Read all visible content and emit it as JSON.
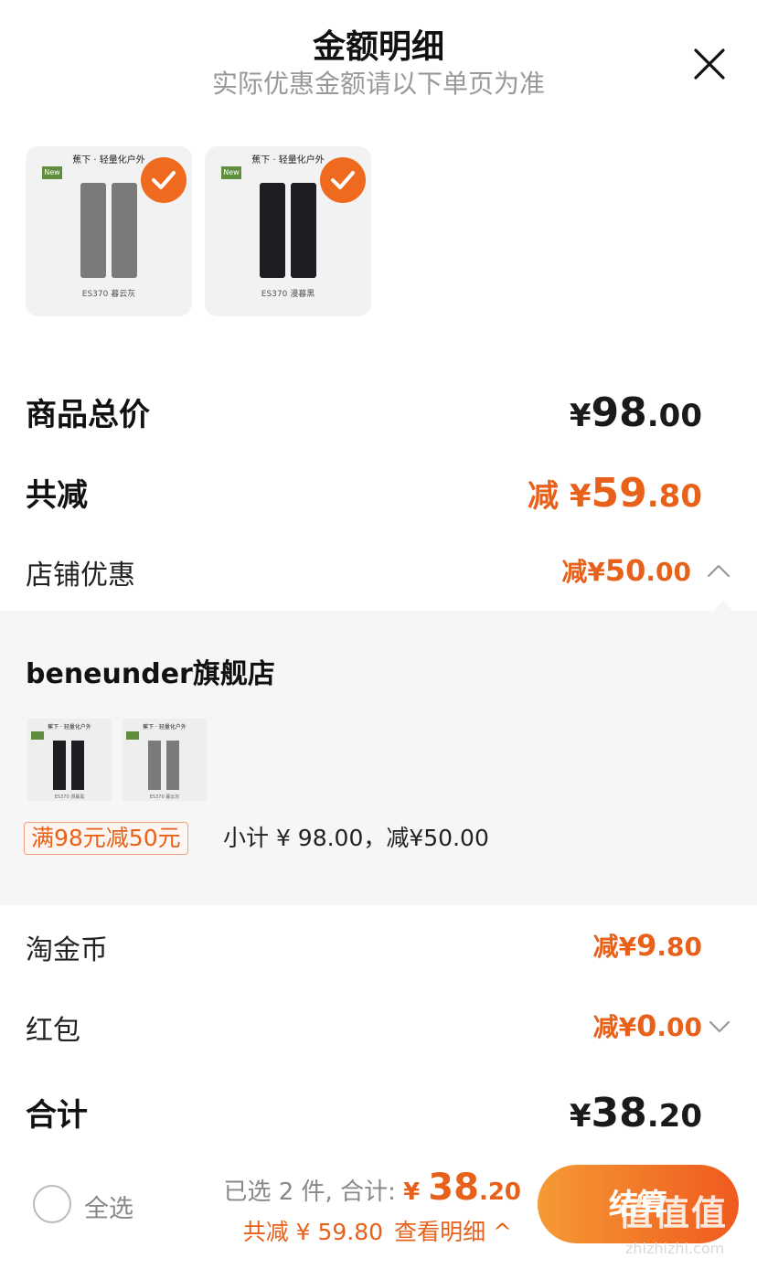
{
  "header": {
    "title": "金额明细",
    "subtitle": "实际优惠金额请以下单页为准",
    "close_icon": "close-icon"
  },
  "products": [
    {
      "brand_line": "蕉下 · 轻量化户外",
      "badge": "New",
      "caption": "ES370 暮云灰",
      "color": "#7a7a7a",
      "selected": true
    },
    {
      "brand_line": "蕉下 · 轻量化户外",
      "badge": "New",
      "caption": "ES370 漫暮黑",
      "color": "#1e1e22",
      "selected": true
    }
  ],
  "summary": {
    "goods_total_label": "商品总价",
    "goods_total_currency": "¥",
    "goods_total_int": "98",
    "goods_total_dec": ".00",
    "total_reduce_label": "共减",
    "total_reduce_prefix": "减 ¥",
    "total_reduce_int": "59",
    "total_reduce_dec": ".80",
    "store_discount_label": "店铺优惠",
    "store_discount_prefix": "减¥",
    "store_discount_int": "50",
    "store_discount_dec": ".00"
  },
  "store_panel": {
    "store_name": "beneunder旗舰店",
    "items": [
      {
        "brand_line": "蕉下 · 轻量化户外",
        "badge": "New",
        "caption": "ES370 漫暮黑",
        "color": "#1e1e22"
      },
      {
        "brand_line": "蕉下 · 轻量化户外",
        "badge": "New",
        "caption": "ES370 暮云灰",
        "color": "#7a7a7a"
      }
    ],
    "promo_tag": "满98元减50元",
    "promo_text": "小计 ¥ 98.00，减¥50.00"
  },
  "coins": {
    "label": "淘金币",
    "prefix": "减¥",
    "int": "9",
    "dec": ".80"
  },
  "red_packet": {
    "label": "红包",
    "prefix": "减¥",
    "int": "0",
    "dec": ".00"
  },
  "total": {
    "label": "合计",
    "currency": "¥",
    "int": "38",
    "dec": ".20"
  },
  "footer": {
    "select_all": "全选",
    "selected_text": "已选 2 件, 合计: ",
    "currency": "¥ ",
    "amount_int": "38",
    "amount_dec": ".20",
    "reduce_text": "共减 ¥ 59.80",
    "detail_link": "查看明细 ^",
    "checkout_label": "结算"
  },
  "watermark": {
    "text": "值值值",
    "url": "zhizhizhi.com"
  },
  "colors": {
    "accent": "#e8611a",
    "checkout_start": "#f59a35",
    "checkout_end": "#ef5a1e",
    "panel_bg": "#f6f6f6"
  }
}
